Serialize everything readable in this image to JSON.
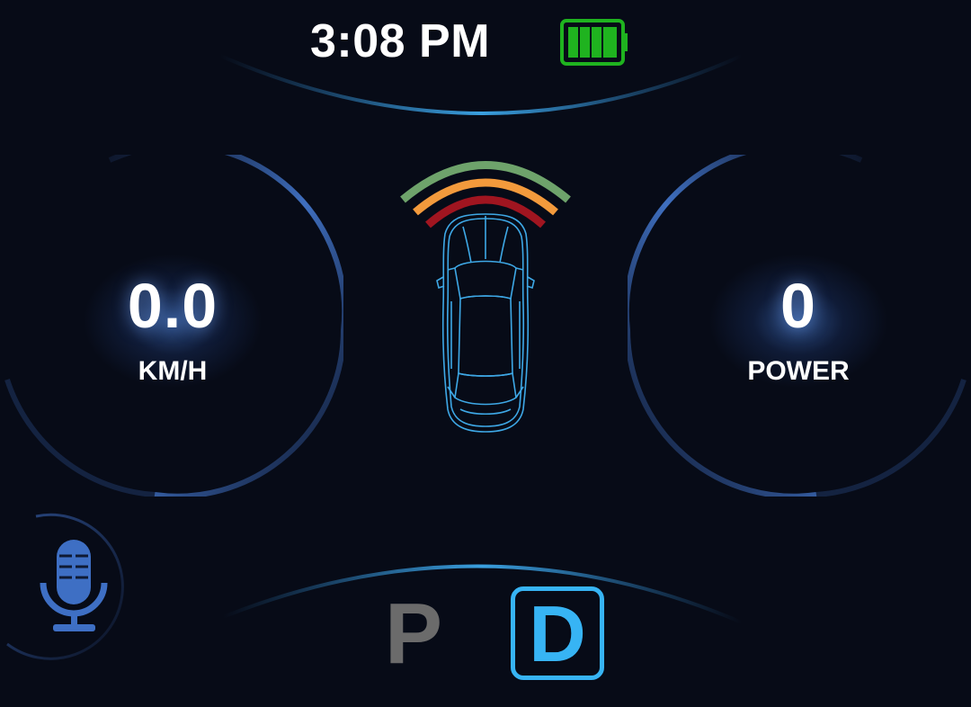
{
  "status_bar": {
    "time": "3:08 PM",
    "battery_level": 1.0,
    "battery_color": "#1fb31f"
  },
  "speed_gauge": {
    "value": "0.0",
    "unit": "KM/H"
  },
  "power_gauge": {
    "value": "0",
    "unit": "POWER"
  },
  "proximity_sensor": {
    "arc_colors": [
      "#6ea36b",
      "#f39a3c",
      "#a01520"
    ]
  },
  "voice": {
    "icon": "microphone-icon",
    "color": "#3e6fc4"
  },
  "gear_selector": {
    "options": [
      {
        "label": "P",
        "active": false
      },
      {
        "label": "D",
        "active": true
      }
    ],
    "active_color": "#37b4f4",
    "inactive_color": "#6b6b6b"
  },
  "colors": {
    "background": "#070b17",
    "accent": "#2f83c7",
    "car_outline": "#3ea8e6"
  }
}
